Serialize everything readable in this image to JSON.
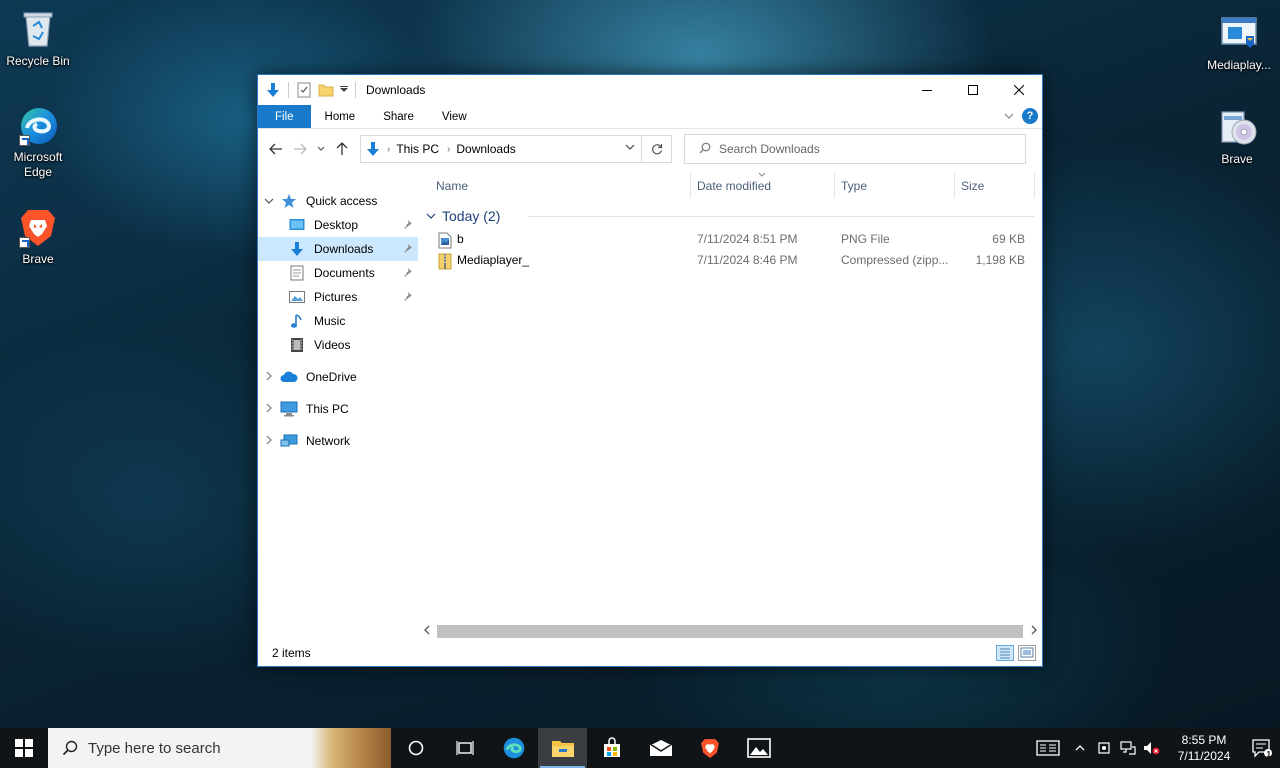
{
  "desktop": {
    "icons_left": [
      {
        "label": "Recycle Bin",
        "icon": "recycle-bin-icon"
      },
      {
        "label": "Microsoft Edge",
        "icon": "edge-icon"
      },
      {
        "label": "Brave",
        "icon": "brave-icon"
      }
    ],
    "icons_right": [
      {
        "label": "Mediaplay...",
        "icon": "installer-icon"
      },
      {
        "label": "Brave",
        "icon": "setup-cd-icon"
      }
    ]
  },
  "window": {
    "title": "Downloads",
    "ribbon_tabs": [
      "File",
      "Home",
      "Share",
      "View"
    ],
    "help_label": "?",
    "address": {
      "crumbs": [
        "This PC",
        "Downloads"
      ]
    },
    "search_placeholder": "Search Downloads",
    "nav_pane": {
      "quick_access": "Quick access",
      "quick_items": [
        "Desktop",
        "Downloads",
        "Documents",
        "Pictures",
        "Music",
        "Videos"
      ],
      "selected": "Downloads",
      "roots": [
        "OneDrive",
        "This PC",
        "Network"
      ]
    },
    "columns": [
      "Name",
      "Date modified",
      "Type",
      "Size"
    ],
    "group_label": "Today (2)",
    "files": [
      {
        "name": "b",
        "date": "7/11/2024 8:51 PM",
        "type": "PNG File",
        "size": "69 KB",
        "icon": "png-file-icon"
      },
      {
        "name": "Mediaplayer_",
        "date": "7/11/2024 8:46 PM",
        "type": "Compressed (zipp...",
        "size": "1,198 KB",
        "icon": "zip-folder-icon"
      }
    ],
    "status_text": "2 items"
  },
  "taskbar": {
    "search_placeholder": "Type here to search",
    "time": "8:55 PM",
    "date": "7/11/2024",
    "notification_count": "1"
  },
  "colors": {
    "accent": "#1979ca",
    "selection": "#cce8ff",
    "taskbar": "#111417"
  }
}
